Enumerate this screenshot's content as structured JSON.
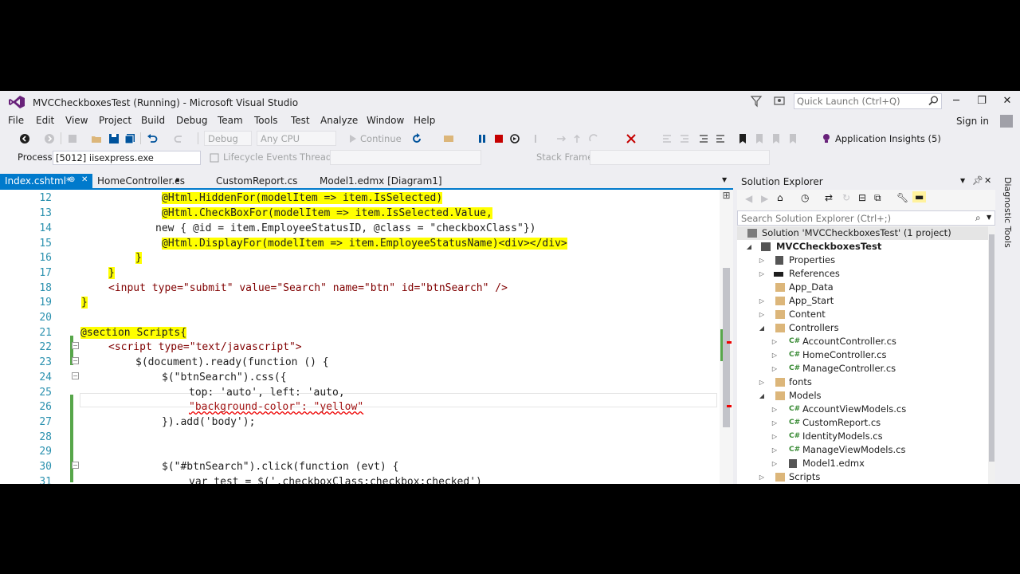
{
  "window": {
    "title": "MVCCheckboxesTest (Running) - Microsoft Visual Studio",
    "quick_launch_placeholder": "Quick Launch (Ctrl+Q)",
    "controls": {
      "minimize": "─",
      "restore": "❐",
      "close": "✕"
    }
  },
  "menu": [
    "File",
    "Edit",
    "View",
    "Project",
    "Build",
    "Debug",
    "Team",
    "Tools",
    "Test",
    "Analyze",
    "Window",
    "Help"
  ],
  "account": {
    "sign_in": "Sign in"
  },
  "toolbar": {
    "config": "Debug",
    "platform": "Any CPU",
    "continue": "Continue",
    "app_insights": "Application Insights (5)"
  },
  "debug_location": {
    "process_label": "Process:",
    "process_value": "[5012] iisexpress.exe",
    "lifecycle": "Lifecycle Events",
    "thread_label": "Thread:",
    "stack_label": "Stack Frame:"
  },
  "tabs": [
    {
      "label": "Index.cshtml*",
      "active": true
    },
    {
      "label": "HomeController.cs"
    },
    {
      "label": "CustomReport.cs"
    },
    {
      "label": "Model1.edmx [Diagram1]"
    }
  ],
  "code_lines": [
    {
      "num": "12",
      "text": "@Html.HiddenFor(modelItem => item.IsSelected)"
    },
    {
      "num": "13",
      "text": "@Html.CheckBoxFor(modelItem => item.IsSelected.Value,"
    },
    {
      "num": "14",
      "text": "new { @id = item.EmployeeStatusID, @class = \"checkboxClass\"})"
    },
    {
      "num": "15",
      "text": "@Html.DisplayFor(modelItem => item.EmployeeStatusName)<div></div>"
    },
    {
      "num": "16",
      "text": "}"
    },
    {
      "num": "17",
      "text": "}"
    },
    {
      "num": "18",
      "text": "<input type=\"submit\" value=\"Search\" name=\"btn\" id=\"btnSearch\" />"
    },
    {
      "num": "19",
      "text": "}"
    },
    {
      "num": "20",
      "text": ""
    },
    {
      "num": "21",
      "text": "@section Scripts{"
    },
    {
      "num": "22",
      "text": "<script type=\"text/javascript\">"
    },
    {
      "num": "23",
      "text": "$(document).ready(function () {"
    },
    {
      "num": "24",
      "text": "$(\"btnSearch\").css({"
    },
    {
      "num": "25",
      "text": "top: 'auto', left: 'auto,"
    },
    {
      "num": "26",
      "text": "\"background-color\": \"yellow\""
    },
    {
      "num": "27",
      "text": "}).add('body');"
    },
    {
      "num": "28",
      "text": ""
    },
    {
      "num": "29",
      "text": ""
    },
    {
      "num": "30",
      "text": "$(\"#btnSearch\").click(function (evt) {"
    },
    {
      "num": "31",
      "text": "var test = $('.checkboxClass:checkbox:checked')"
    }
  ],
  "solution_explorer": {
    "title": "Solution Explorer",
    "search_placeholder": "Search Solution Explorer (Ctrl+;)",
    "items": [
      {
        "label": "Solution 'MVCCheckboxesTest' (1 project)"
      },
      {
        "label": "MVCCheckboxesTest"
      },
      {
        "label": "Properties"
      },
      {
        "label": "References"
      },
      {
        "label": "App_Data"
      },
      {
        "label": "App_Start"
      },
      {
        "label": "Content"
      },
      {
        "label": "Controllers"
      },
      {
        "label": "AccountController.cs"
      },
      {
        "label": "HomeController.cs"
      },
      {
        "label": "ManageController.cs"
      },
      {
        "label": "fonts"
      },
      {
        "label": "Models"
      },
      {
        "label": "AccountViewModels.cs"
      },
      {
        "label": "CustomReport.cs"
      },
      {
        "label": "IdentityModels.cs"
      },
      {
        "label": "ManageViewModels.cs"
      },
      {
        "label": "Model1.edmx"
      },
      {
        "label": "Scripts"
      }
    ]
  },
  "side_panel": {
    "diagnostic_tools": "Diagnostic Tools"
  },
  "colors": {
    "accent": "#007acc",
    "background": "#eeeef2",
    "razor_highlight": "#ffff00"
  }
}
